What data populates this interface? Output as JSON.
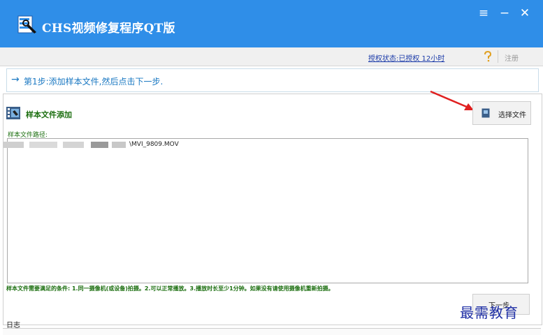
{
  "window": {
    "title": "CHS视频修复程序QT版",
    "controls": [
      "menu-icon",
      "minimize-icon",
      "close-icon"
    ]
  },
  "statusbar": {
    "auth_status": "授权状态:已授权  12小时",
    "register_label": "注册"
  },
  "step": {
    "arrow": "→",
    "text": "第1步:添加样本文件,然后点击下一步."
  },
  "sample": {
    "section_title": "样本文件添加",
    "choose_button_label": "选择文件",
    "path_label": "样本文件路径:",
    "path_value": "\\MVI_9809.MOV",
    "requirements_note": "样本文件需要满足的条件: 1.同一摄像机(或设备)拍摄。2.可以正常播放。3.播放时长至少1分钟。如果没有请使用摄像机重新拍摄。"
  },
  "next_button_label": "下一步",
  "log": {
    "title": "日志"
  },
  "watermark": "最需教育",
  "colors": {
    "titlebar": "#2f8ee8",
    "step_text": "#1a78c2",
    "green_text": "#1b6e0f",
    "link": "#1a3aa8"
  }
}
